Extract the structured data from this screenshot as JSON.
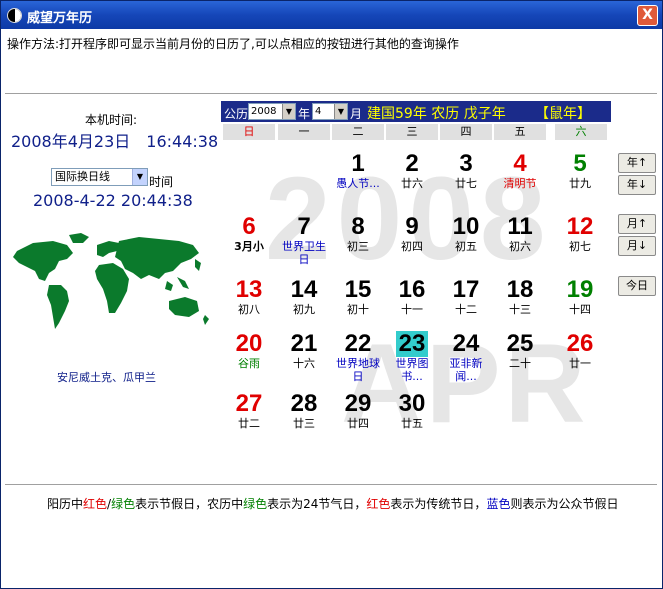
{
  "window": {
    "title": "威望万年历",
    "close_label": "X"
  },
  "instruction": "操作方法:打开程序即可显示当前月份的日历了,可以点相应的按钮进行其他的查询操作",
  "left": {
    "local_time_label": "本机时间:",
    "local_time": "2008年4月23日　16:44:38",
    "zone_select": "国际换日线",
    "zone_label": "时间",
    "zone_time": "2008-4-22 20:44:38",
    "zone_cities": "安尼威土克、瓜甲兰"
  },
  "header": {
    "calendar_label": "公历",
    "year": "2008",
    "year_label": "年",
    "month": "4",
    "month_label": "月",
    "era_info": "建国59年 农历 戊子年",
    "zodiac": "【鼠年】"
  },
  "weekdays": [
    "日",
    "一",
    "二",
    "三",
    "四",
    "五",
    "六"
  ],
  "watermark": {
    "year": "2008",
    "month": "APR"
  },
  "days": [
    {
      "day": "1",
      "sub": "愚人节...",
      "col": 2,
      "row": 0,
      "color": "#000000",
      "sub_color": "#0000c0"
    },
    {
      "day": "2",
      "sub": "廿六",
      "col": 3,
      "row": 0,
      "color": "#000000",
      "sub_color": "#000000"
    },
    {
      "day": "3",
      "sub": "廿七",
      "col": 4,
      "row": 0,
      "color": "#000000",
      "sub_color": "#000000"
    },
    {
      "day": "4",
      "sub": "清明节",
      "col": 5,
      "row": 0,
      "color": "#e00000",
      "sub_color": "#e00000"
    },
    {
      "day": "5",
      "sub": "廿九",
      "col": 6,
      "row": 0,
      "color": "#008000",
      "sub_color": "#000000"
    },
    {
      "day": "6",
      "sub": "3月小",
      "col": 0,
      "row": 1,
      "color": "#e00000",
      "sub_color": "#000000",
      "sub_bold": true
    },
    {
      "day": "7",
      "sub": "世界卫生日",
      "col": 1,
      "row": 1,
      "color": "#000000",
      "sub_color": "#0000c0"
    },
    {
      "day": "8",
      "sub": "初三",
      "col": 2,
      "row": 1,
      "color": "#000000",
      "sub_color": "#000000"
    },
    {
      "day": "9",
      "sub": "初四",
      "col": 3,
      "row": 1,
      "color": "#000000",
      "sub_color": "#000000"
    },
    {
      "day": "10",
      "sub": "初五",
      "col": 4,
      "row": 1,
      "color": "#000000",
      "sub_color": "#000000"
    },
    {
      "day": "11",
      "sub": "初六",
      "col": 5,
      "row": 1,
      "color": "#000000",
      "sub_color": "#000000"
    },
    {
      "day": "12",
      "sub": "初七",
      "col": 6,
      "row": 1,
      "color": "#e00000",
      "sub_color": "#000000"
    },
    {
      "day": "13",
      "sub": "初八",
      "col": 0,
      "row": 2,
      "color": "#e00000",
      "sub_color": "#000000"
    },
    {
      "day": "14",
      "sub": "初九",
      "col": 1,
      "row": 2,
      "color": "#000000",
      "sub_color": "#000000"
    },
    {
      "day": "15",
      "sub": "初十",
      "col": 2,
      "row": 2,
      "color": "#000000",
      "sub_color": "#000000"
    },
    {
      "day": "16",
      "sub": "十一",
      "col": 3,
      "row": 2,
      "color": "#000000",
      "sub_color": "#000000"
    },
    {
      "day": "17",
      "sub": "十二",
      "col": 4,
      "row": 2,
      "color": "#000000",
      "sub_color": "#000000"
    },
    {
      "day": "18",
      "sub": "十三",
      "col": 5,
      "row": 2,
      "color": "#000000",
      "sub_color": "#000000"
    },
    {
      "day": "19",
      "sub": "十四",
      "col": 6,
      "row": 2,
      "color": "#008000",
      "sub_color": "#000000"
    },
    {
      "day": "20",
      "sub": "谷雨",
      "col": 0,
      "row": 3,
      "color": "#e00000",
      "sub_color": "#008000"
    },
    {
      "day": "21",
      "sub": "十六",
      "col": 1,
      "row": 3,
      "color": "#000000",
      "sub_color": "#000000"
    },
    {
      "day": "22",
      "sub": "世界地球日",
      "col": 2,
      "row": 3,
      "color": "#000000",
      "sub_color": "#0000c0"
    },
    {
      "day": "23",
      "sub": "世界图书...",
      "col": 3,
      "row": 3,
      "color": "#000000",
      "sub_color": "#0000c0",
      "today": true
    },
    {
      "day": "24",
      "sub": "亚非新闻...",
      "col": 4,
      "row": 3,
      "color": "#000000",
      "sub_color": "#0000c0"
    },
    {
      "day": "25",
      "sub": "二十",
      "col": 5,
      "row": 3,
      "color": "#000000",
      "sub_color": "#000000"
    },
    {
      "day": "26",
      "sub": "廿一",
      "col": 6,
      "row": 3,
      "color": "#e00000",
      "sub_color": "#000000"
    },
    {
      "day": "27",
      "sub": "廿二",
      "col": 0,
      "row": 4,
      "color": "#e00000",
      "sub_color": "#000000"
    },
    {
      "day": "28",
      "sub": "廿三",
      "col": 1,
      "row": 4,
      "color": "#000000",
      "sub_color": "#000000"
    },
    {
      "day": "29",
      "sub": "廿四",
      "col": 2,
      "row": 4,
      "color": "#000000",
      "sub_color": "#000000"
    },
    {
      "day": "30",
      "sub": "廿五",
      "col": 3,
      "row": 4,
      "color": "#000000",
      "sub_color": "#000000"
    }
  ],
  "buttons": {
    "year_up": "年↑",
    "year_down": "年↓",
    "month_up": "月↑",
    "month_down": "月↓",
    "today": "今日"
  },
  "legend": {
    "p1": "阳历中",
    "red1": "红色",
    "slash": "/",
    "green1": "绿色",
    "p2": "表示节假日，农历中",
    "green2": "绿色",
    "p3": "表示为24节气日，",
    "red2": "红色",
    "p4": "表示为传统节日，",
    "blue": "蓝色",
    "p5": "则表示为公众节假日"
  }
}
